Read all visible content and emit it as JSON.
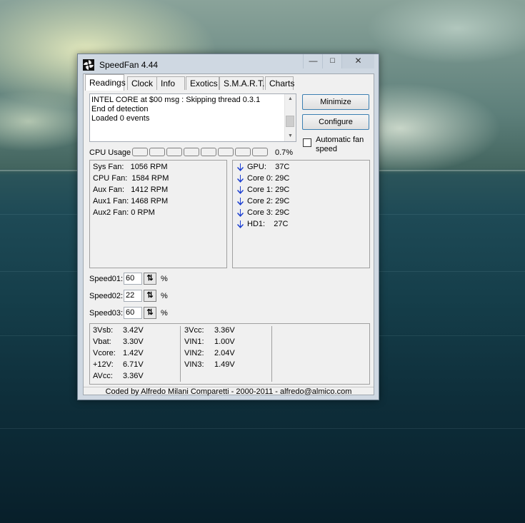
{
  "window": {
    "title": "SpeedFan 4.44",
    "min_glyph": "—",
    "max_glyph": "☐",
    "close_glyph": "✕"
  },
  "tabs": [
    "Readings",
    "Clock",
    "Info",
    "Exotics",
    "S.M.A.R.T.",
    "Charts"
  ],
  "log": {
    "lines": [
      "INTEL CORE at $00 msg : Skipping thread 0.3.1",
      "End of detection",
      "Loaded 0 events"
    ]
  },
  "buttons": {
    "minimize": "Minimize",
    "configure": "Configure"
  },
  "auto_fan": {
    "label": "Automatic fan speed",
    "checked": false
  },
  "cpu_usage": {
    "label": "CPU Usage",
    "value": "0.7%",
    "cores": 8
  },
  "fans": [
    {
      "text": "Sys Fan:   1056 RPM"
    },
    {
      "text": "CPU Fan:  1584 RPM"
    },
    {
      "text": "Aux Fan:   1412 RPM"
    },
    {
      "text": "Aux1 Fan: 1468 RPM"
    },
    {
      "text": "Aux2 Fan: 0 RPM"
    }
  ],
  "temps": [
    {
      "text": "GPU:    37C",
      "trend": "down"
    },
    {
      "text": "Core 0: 29C",
      "trend": "down"
    },
    {
      "text": "Core 1: 29C",
      "trend": "down"
    },
    {
      "text": "Core 2: 29C",
      "trend": "down"
    },
    {
      "text": "Core 3: 29C",
      "trend": "down"
    },
    {
      "text": "HD1:    27C",
      "trend": "down"
    }
  ],
  "speeds": [
    {
      "label": "Speed01:",
      "value": "60",
      "unit": "%"
    },
    {
      "label": "Speed02:",
      "value": "22",
      "unit": "%"
    },
    {
      "label": "Speed03:",
      "value": "60",
      "unit": "%"
    }
  ],
  "voltages": {
    "col1": [
      {
        "name": "3Vsb:",
        "value": "3.42V"
      },
      {
        "name": "Vbat:",
        "value": "3.30V"
      },
      {
        "name": "Vcore:",
        "value": "1.42V"
      },
      {
        "name": "+12V:",
        "value": "6.71V"
      },
      {
        "name": "AVcc:",
        "value": "3.36V"
      }
    ],
    "col2": [
      {
        "name": "3Vcc:",
        "value": "3.36V"
      },
      {
        "name": "VIN1:",
        "value": "1.00V"
      },
      {
        "name": "VIN2:",
        "value": "2.04V"
      },
      {
        "name": "VIN3:",
        "value": "1.49V"
      }
    ]
  },
  "footer": "Coded by Alfredo Milani Comparetti - 2000-2011 - alfredo@almico.com",
  "colors": {
    "accent": "#3c7fb1",
    "arrow": "#1c3fd1"
  }
}
